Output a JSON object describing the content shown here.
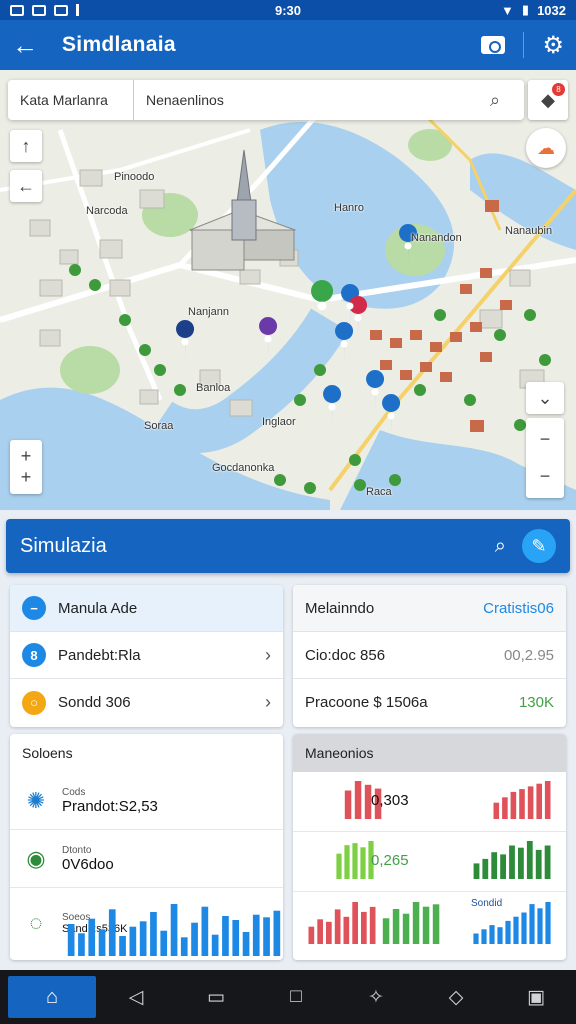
{
  "status_bar": {
    "time": "9:30",
    "battery_text": "1032"
  },
  "app_bar": {
    "title": "Simdlanaia"
  },
  "map": {
    "search": {
      "location": "Kata Marlanra",
      "query": "Nenaenlinos"
    },
    "labels": [
      "Pinoodo",
      "Narcoda",
      "Nanjann",
      "Hanro",
      "Nanandon",
      "Nanaubin",
      "Banloa",
      "Soraa",
      "Inglaor",
      "Gocdanonka",
      "Raca"
    ],
    "badge_count": "8"
  },
  "simulation": {
    "title": "Simulazia"
  },
  "left_list": [
    {
      "label": "Manula Ade",
      "icon": "minus-circle-icon"
    },
    {
      "label": "Pandebt:Rla",
      "icon": "route-icon"
    },
    {
      "label": "Sondd 306",
      "icon": "ring-icon"
    }
  ],
  "right_list": {
    "header": {
      "label": "Melainndo",
      "value": "Cratistis06"
    },
    "rows": [
      {
        "label": "Cio:doc 856",
        "value": "00,2.95"
      },
      {
        "label": "Pracoone $ 1506a",
        "value": "130K"
      }
    ]
  },
  "solutions": {
    "title": "Soloens",
    "items": [
      {
        "small": "Cods",
        "big": "Prandot:S2,53",
        "icon": "star-burst-icon"
      },
      {
        "small": "Dtonto",
        "big": "0V6doo",
        "icon": "leaf-circle-icon"
      },
      {
        "small": "Soeos",
        "big": "Sandk:s536K",
        "icon": "pulse-circle-icon"
      }
    ]
  },
  "monitors": {
    "title": "Maneonios",
    "items": [
      {
        "value": "0,303"
      },
      {
        "value": "0,265"
      },
      {
        "label": "Sondid"
      }
    ]
  },
  "charts": {
    "solutions_bars": [
      24,
      17,
      28,
      20,
      35,
      15,
      22,
      26,
      33,
      19,
      39,
      14,
      25,
      37,
      16,
      30,
      27,
      18,
      31,
      29,
      34
    ],
    "monitor_mini": [
      {
        "color": "#e0525a",
        "values": [
          15,
          20,
          18,
          16
        ]
      },
      {
        "color": "#e0525a",
        "values": [
          12,
          16,
          20,
          22,
          24,
          26,
          28
        ]
      },
      {
        "color": "#7dd044",
        "values": [
          12,
          16,
          17,
          15,
          18
        ]
      },
      {
        "color": "#2e8b3a",
        "values": [
          14,
          18,
          24,
          22,
          30,
          28,
          34,
          26,
          30
        ]
      },
      {
        "color": "#e0525a",
        "values": [
          14,
          20,
          18,
          28,
          22,
          34,
          26,
          30
        ]
      },
      {
        "color": "#4caf50",
        "values": [
          22,
          30,
          26,
          36,
          32,
          34
        ]
      },
      {
        "color": "#1e88e5",
        "values": [
          10,
          14,
          18,
          16,
          22,
          26,
          30,
          38,
          34,
          40
        ]
      }
    ],
    "colors": {
      "blue": "#1e88e5"
    }
  }
}
